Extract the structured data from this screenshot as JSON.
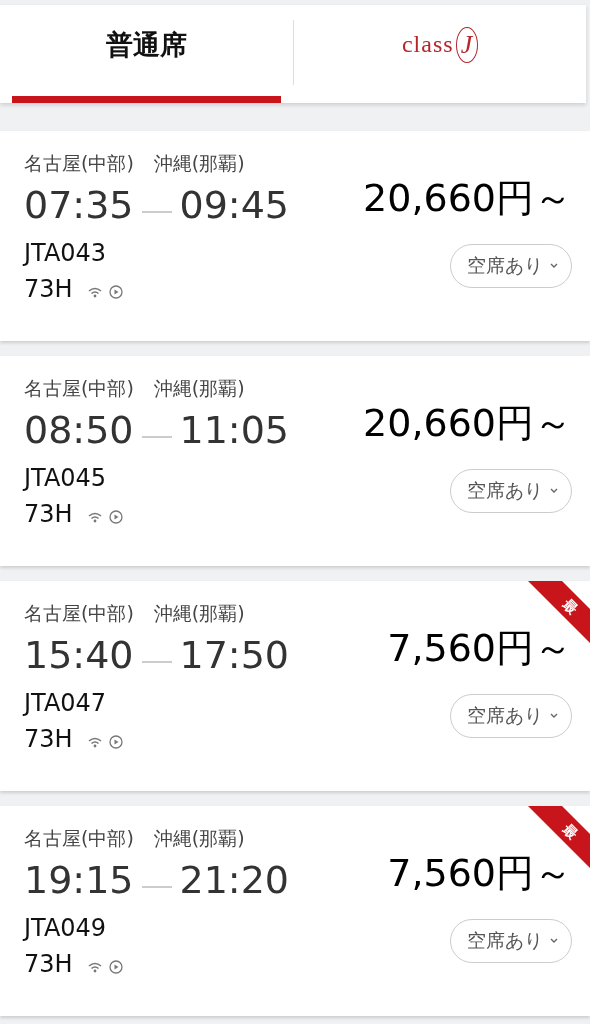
{
  "tabs": [
    {
      "kind": "text",
      "label": "普通席",
      "selected": true
    },
    {
      "kind": "logo",
      "label": "class",
      "mark": "J",
      "selected": false
    }
  ],
  "flights": [
    {
      "from": "名古屋(中部)",
      "to": "沖縄(那覇)",
      "depart": "07:35",
      "arrive": "09:45",
      "flight": "JTA043",
      "aircraft": "73H",
      "price": "20,660円～",
      "availability": "空席あり"
    },
    {
      "from": "名古屋(中部)",
      "to": "沖縄(那覇)",
      "depart": "08:50",
      "arrive": "11:05",
      "flight": "JTA045",
      "aircraft": "73H",
      "price": "20,660円～",
      "availability": "空席あり"
    },
    {
      "from": "名古屋(中部)",
      "to": "沖縄(那覇)",
      "depart": "15:40",
      "arrive": "17:50",
      "flight": "JTA047",
      "aircraft": "73H",
      "price": "7,560円～",
      "availability": "空席あり",
      "badge": "最"
    },
    {
      "from": "名古屋(中部)",
      "to": "沖縄(那覇)",
      "depart": "19:15",
      "arrive": "21:20",
      "flight": "JTA049",
      "aircraft": "73H",
      "price": "7,560円～",
      "availability": "空席あり",
      "badge": "最"
    }
  ]
}
